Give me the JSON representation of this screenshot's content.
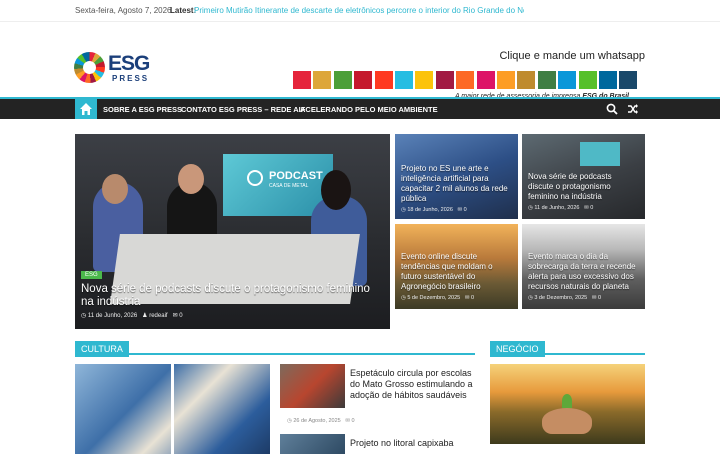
{
  "topbar": {
    "date": "Sexta-feira, Agosto 7, 2026",
    "latest_label": "Latest:",
    "ticker": "Primeiro Mutirão Itinerante de descarte de eletrônicos percorre o interior do Rio Grande do Norte"
  },
  "header": {
    "logo_text": "ESG",
    "logo_sub": "PRESS",
    "whatsapp": "Clique e mande um whatsapp",
    "banner_caption_pre": "A maior rede de assessoria de imprensa ",
    "banner_caption_brand": "ESG do Brasil",
    "sdg_colors": [
      "#e5243b",
      "#dda63a",
      "#4c9f38",
      "#c5192d",
      "#ff3a21",
      "#26bde2",
      "#fcc30b",
      "#a21942",
      "#fd6925",
      "#dd1367",
      "#fd9d24",
      "#bf8b2e",
      "#3f7e44",
      "#0a97d9",
      "#56c02b",
      "#00689d",
      "#19486a"
    ]
  },
  "nav": {
    "home_icon": "home-icon",
    "items": [
      "SOBRE A ESG PRESS",
      "CONTATO ESG PRESS – REDE AIF",
      "ACELERANDO PELO MEIO AMBIENTE"
    ],
    "search_icon": "search-icon",
    "random_icon": "shuffle-icon",
    "accent": "#2fb8d0"
  },
  "featured": {
    "tag": "ESG",
    "title": "Nova série de podcasts discute o protagonismo feminino na indústria",
    "date": "11 de Junho, 2026",
    "author": "redeaif",
    "comments": "0",
    "screen_line1": "PODCAST",
    "screen_line2": "CASA DE METAL"
  },
  "grid": [
    {
      "title": "Projeto no ES une arte e inteligência artificial para capacitar 2 mil alunos da rede pública",
      "date": "18 de Junho, 2026",
      "comments": "0"
    },
    {
      "title": "Nova série de podcasts discute o protagonismo feminino na indústria",
      "date": "11 de Junho, 2026",
      "comments": "0"
    },
    {
      "title": "Evento online discute tendências que moldam o futuro sustentável do Agronegócio brasileiro",
      "date": "5 de Dezembro, 2025",
      "comments": "0"
    },
    {
      "title": "Evento marca o dia da sobrecarga da terra e recende alerta para uso excessivo dos recursos naturais do planeta",
      "date": "3 de Dezembro, 2025",
      "comments": "0"
    }
  ],
  "sections": {
    "cultura": "CULTURA",
    "negocio": "NEGÓCIO"
  },
  "cultura_articles": [
    {
      "title": "Espetáculo circula por escolas do Mato Grosso estimulando a adoção de hábitos saudáveis",
      "date": "26 de Agosto, 2025",
      "comments": "0"
    },
    {
      "title": "Projeto no litoral capixaba",
      "date": "",
      "comments": ""
    }
  ]
}
